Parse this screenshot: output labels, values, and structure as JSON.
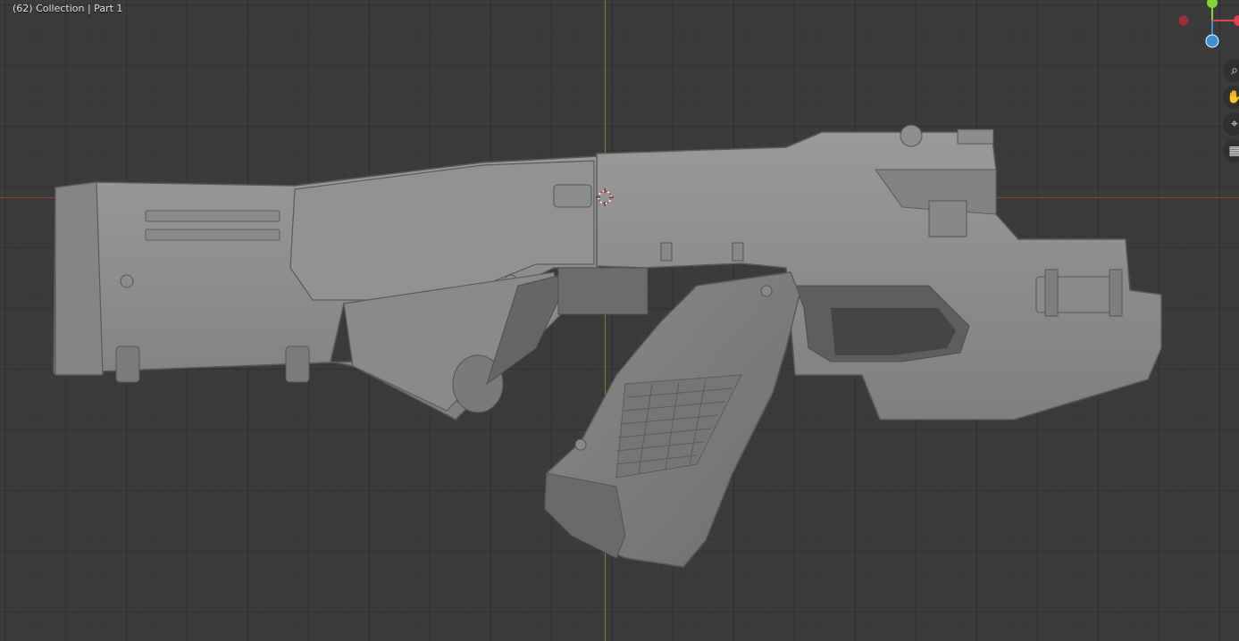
{
  "viewport": {
    "info_text": "(62) Collection | Part 1"
  },
  "gizmo": {
    "x_color": "#e4404f",
    "y_color": "#8bd13a",
    "z_color": "#3f8fd8",
    "neg_x_color": "#9b2f3a"
  },
  "nav_tools": {
    "zoom_icon": "zoom-icon",
    "pan_icon": "hand-icon",
    "camera_icon": "camera-icon",
    "grid_icon": "grid-icon"
  },
  "colors": {
    "viewport_bg": "#3b3b3b",
    "axis_x": "#9a3b41",
    "axis_y": "#6f8a2c",
    "model_gray": "#8f8f8f"
  }
}
